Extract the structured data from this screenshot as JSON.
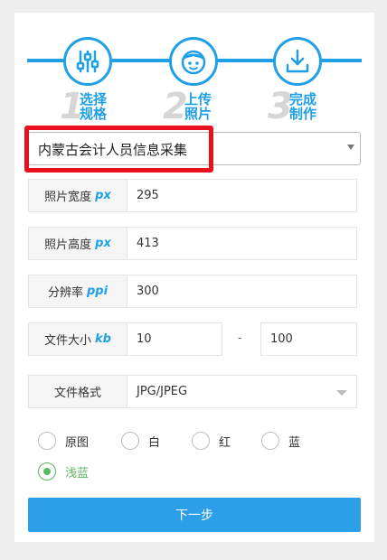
{
  "steps": [
    {
      "num": "1",
      "label_line1": "选择",
      "label_line2": "规格",
      "icon": "sliders-icon"
    },
    {
      "num": "2",
      "label_line1": "上传",
      "label_line2": "照片",
      "icon": "person-face-icon"
    },
    {
      "num": "3",
      "label_line1": "完成",
      "label_line2": "制作",
      "icon": "download-icon"
    }
  ],
  "template": {
    "selected": "内蒙古会计人员信息采集"
  },
  "fields": {
    "width": {
      "label": "照片宽度",
      "unit": "px",
      "value": "295"
    },
    "height": {
      "label": "照片高度",
      "unit": "px",
      "value": "413"
    },
    "resolution": {
      "label": "分辨率",
      "unit": "ppi",
      "value": "300"
    },
    "filesize": {
      "label": "文件大小",
      "unit": "kb",
      "min": "10",
      "separator": "-",
      "max": "100"
    },
    "format": {
      "label": "文件格式",
      "value": "JPG/JPEG"
    }
  },
  "background_options": [
    {
      "label": "原图",
      "checked": false
    },
    {
      "label": "白",
      "checked": false
    },
    {
      "label": "红",
      "checked": false
    },
    {
      "label": "蓝",
      "checked": false
    },
    {
      "label": "浅蓝",
      "checked": true
    }
  ],
  "next_button": "下一步",
  "colors": {
    "accent": "#1e9fe6",
    "highlight": "#e8101c",
    "checked": "#5cb85c",
    "button": "#2d9fe8"
  }
}
